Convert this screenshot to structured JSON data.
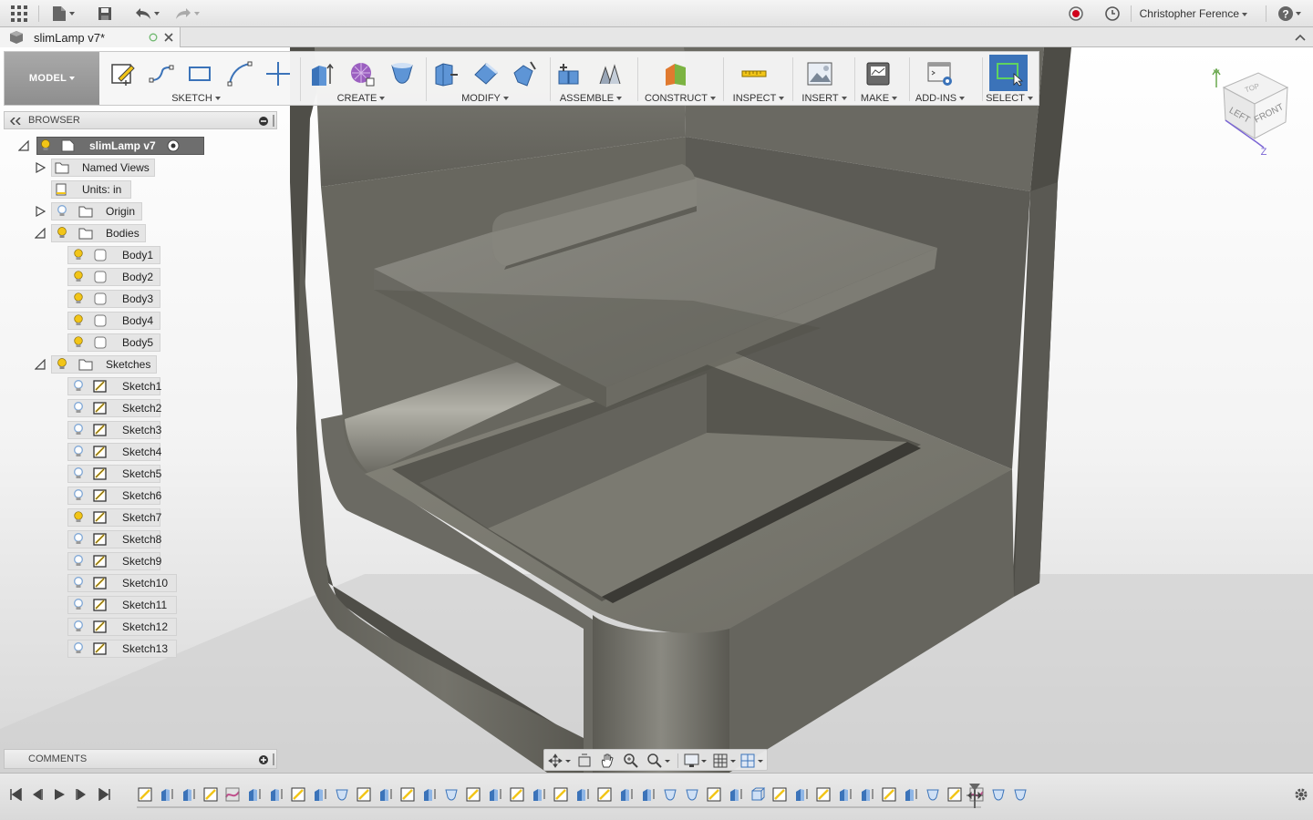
{
  "appbar": {
    "user_name": "Christopher Ference",
    "icons": [
      "grid-icon",
      "file-icon",
      "save-icon",
      "undo-icon",
      "redo-icon",
      "record-icon",
      "clock-icon",
      "help-icon"
    ]
  },
  "document_tab": {
    "title": "slimLamp v7*"
  },
  "toolbar": {
    "workspace": "MODEL",
    "groups": [
      {
        "label": "SKETCH"
      },
      {
        "label": "CREATE"
      },
      {
        "label": "MODIFY"
      },
      {
        "label": "ASSEMBLE"
      },
      {
        "label": "CONSTRUCT"
      },
      {
        "label": "INSPECT"
      },
      {
        "label": "INSERT"
      },
      {
        "label": "MAKE"
      },
      {
        "label": "ADD-INS"
      },
      {
        "label": "SELECT"
      }
    ]
  },
  "browser": {
    "title": "BROWSER",
    "root": "slimLamp v7",
    "named_views": "Named Views",
    "units": "Units: in",
    "origin": "Origin",
    "bodies_label": "Bodies",
    "bodies": [
      "Body1",
      "Body2",
      "Body3",
      "Body4",
      "Body5"
    ],
    "sketches_label": "Sketches",
    "sketches": [
      "Sketch1",
      "Sketch2",
      "Sketch3",
      "Sketch4",
      "Sketch5",
      "Sketch6",
      "Sketch7",
      "Sketch8",
      "Sketch9",
      "Sketch10",
      "Sketch11",
      "Sketch12",
      "Sketch13"
    ],
    "lit_sketches": [
      "Sketch7"
    ]
  },
  "comments": {
    "label": "COMMENTS"
  },
  "viewcube": {
    "left": "LEFT",
    "front": "FRONT",
    "top": "TOP",
    "axis_y": "Y",
    "axis_z": "Z"
  },
  "colors": {
    "accent_blue": "#3b73b9",
    "bulb_yellow": "#f2c518",
    "bulb_blue": "#7fa7d6",
    "model_gray": "#6f6e66"
  }
}
